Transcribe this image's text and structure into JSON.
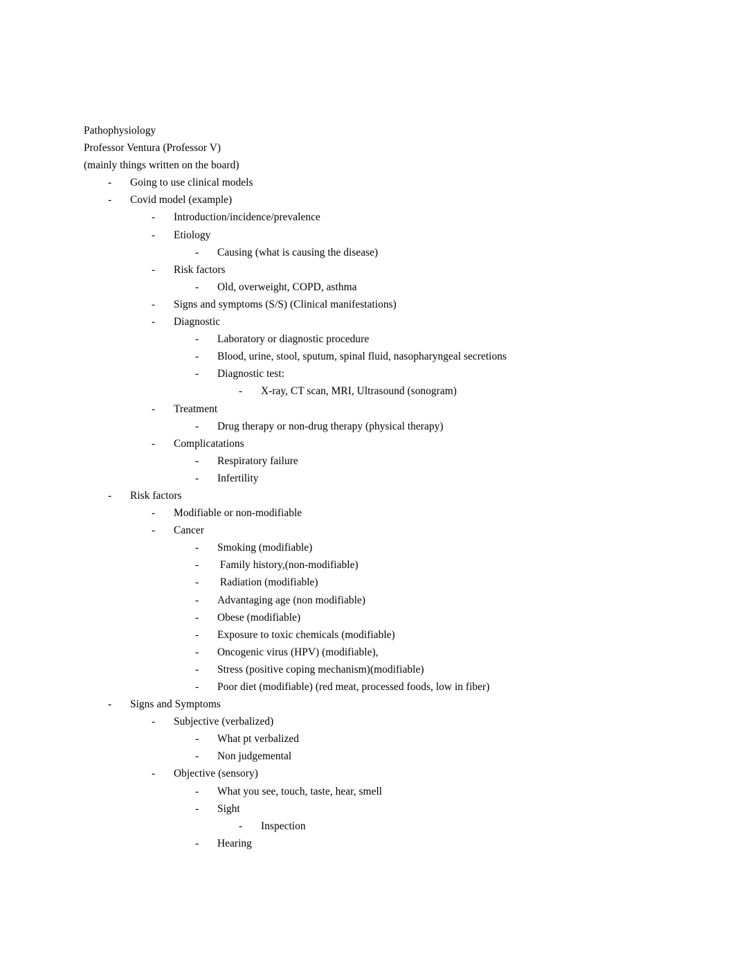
{
  "document": {
    "title": "Pathophysiology",
    "instructor": "Professor Ventura (Professor V)",
    "note": "(mainly things written on the board)",
    "bullet_marker": "-",
    "text_color": "#000000",
    "page_color": "#ffffff"
  },
  "lines": [
    {
      "level": 0,
      "bullet": false,
      "text": "Pathophysiology"
    },
    {
      "level": 0,
      "bullet": false,
      "text": "Professor Ventura (Professor V)"
    },
    {
      "level": 0,
      "bullet": false,
      "text": "(mainly things written on the board)"
    },
    {
      "level": 1,
      "bullet": true,
      "text": "Going to use clinical models"
    },
    {
      "level": 1,
      "bullet": true,
      "text": "Covid model (example)"
    },
    {
      "level": 2,
      "bullet": true,
      "text": "Introduction/incidence/prevalence"
    },
    {
      "level": 2,
      "bullet": true,
      "text": "Etiology"
    },
    {
      "level": 3,
      "bullet": true,
      "text": "Causing (what is causing the disease)"
    },
    {
      "level": 2,
      "bullet": true,
      "text": "Risk factors"
    },
    {
      "level": 3,
      "bullet": true,
      "text": "Old, overweight, COPD, asthma"
    },
    {
      "level": 2,
      "bullet": true,
      "text": "Signs and symptoms (S/S) (Clinical manifestations)"
    },
    {
      "level": 2,
      "bullet": true,
      "text": "Diagnostic"
    },
    {
      "level": 3,
      "bullet": true,
      "text": "Laboratory or diagnostic procedure"
    },
    {
      "level": 3,
      "bullet": true,
      "text": "Blood, urine, stool, sputum, spinal fluid, nasopharyngeal secretions"
    },
    {
      "level": 3,
      "bullet": true,
      "text": "Diagnostic test:"
    },
    {
      "level": 4,
      "bullet": true,
      "text": "X-ray, CT scan, MRI, Ultrasound (sonogram)"
    },
    {
      "level": 2,
      "bullet": true,
      "text": "Treatment"
    },
    {
      "level": 3,
      "bullet": true,
      "text": "Drug therapy or non-drug therapy (physical therapy)"
    },
    {
      "level": 2,
      "bullet": true,
      "text": "Complicatations"
    },
    {
      "level": 3,
      "bullet": true,
      "text": "Respiratory failure"
    },
    {
      "level": 3,
      "bullet": true,
      "text": "Infertility"
    },
    {
      "level": 1,
      "bullet": true,
      "text": "Risk factors"
    },
    {
      "level": 2,
      "bullet": true,
      "text": "Modifiable or non-modifiable"
    },
    {
      "level": 2,
      "bullet": true,
      "text": "Cancer"
    },
    {
      "level": 3,
      "bullet": true,
      "text": "Smoking (modifiable)"
    },
    {
      "level": 3,
      "bullet": true,
      "text": " Family history,(non-modifiable)"
    },
    {
      "level": 3,
      "bullet": true,
      "text": " Radiation (modifiable)"
    },
    {
      "level": 3,
      "bullet": true,
      "text": "Advantaging age (non modifiable)"
    },
    {
      "level": 3,
      "bullet": true,
      "text": "Obese (modifiable)"
    },
    {
      "level": 3,
      "bullet": true,
      "text": "Exposure to toxic chemicals (modifiable)"
    },
    {
      "level": 3,
      "bullet": true,
      "text": "Oncogenic virus (HPV) (modifiable),"
    },
    {
      "level": 3,
      "bullet": true,
      "text": "Stress (positive coping mechanism)(modifiable)"
    },
    {
      "level": 3,
      "bullet": true,
      "text": "Poor diet (modifiable) (red meat, processed foods, low in fiber)"
    },
    {
      "level": 1,
      "bullet": true,
      "text": "Signs and Symptoms"
    },
    {
      "level": 2,
      "bullet": true,
      "text": "Subjective (verbalized)"
    },
    {
      "level": 3,
      "bullet": true,
      "text": "What pt verbalized"
    },
    {
      "level": 3,
      "bullet": true,
      "text": "Non judgemental"
    },
    {
      "level": 2,
      "bullet": true,
      "text": "Objective (sensory)"
    },
    {
      "level": 3,
      "bullet": true,
      "text": "What you see, touch, taste, hear, smell"
    },
    {
      "level": 3,
      "bullet": true,
      "text": "Sight"
    },
    {
      "level": 4,
      "bullet": true,
      "text": "Inspection"
    },
    {
      "level": 3,
      "bullet": true,
      "text": "Hearing"
    }
  ]
}
